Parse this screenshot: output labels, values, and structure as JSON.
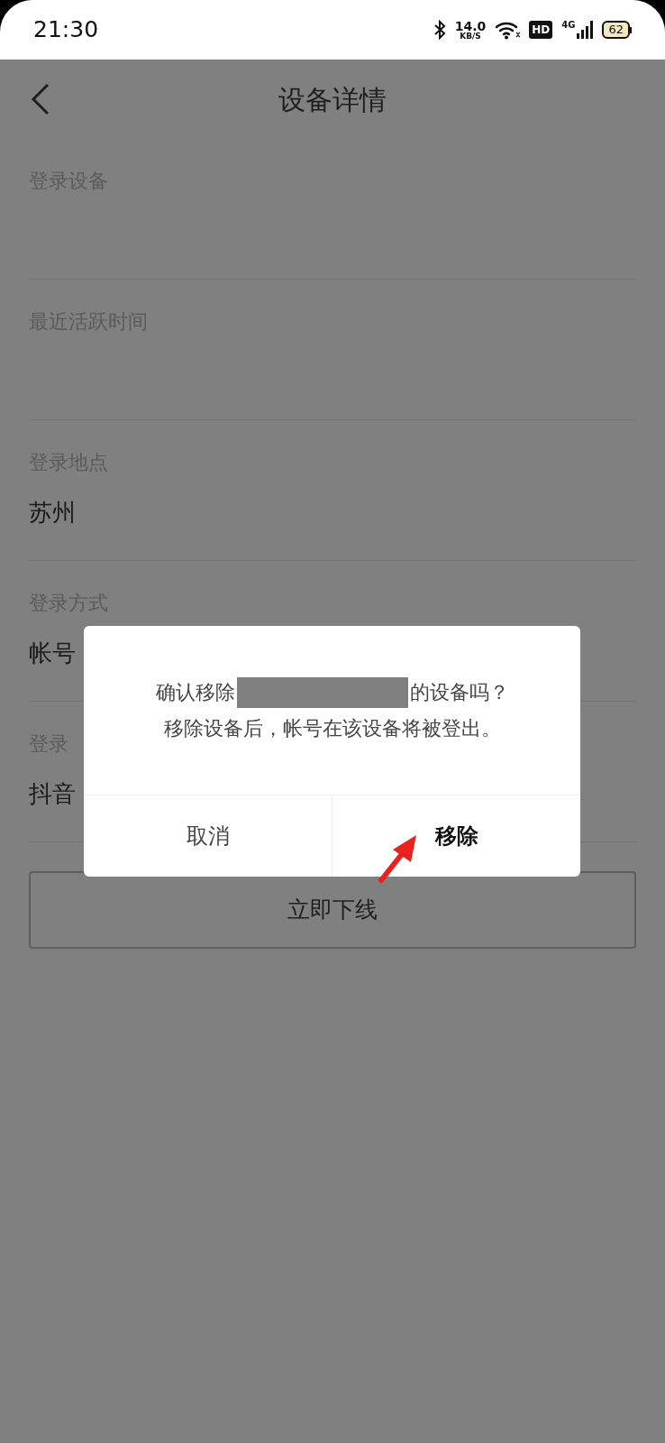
{
  "status_bar": {
    "time": "21:30",
    "net_speed": "14.0",
    "net_unit": "KB/S",
    "hd": "HD",
    "network": "4G",
    "battery": "62"
  },
  "header": {
    "title": "设备详情"
  },
  "fields": [
    {
      "label": "登录设备"
    },
    {
      "label": "最近活跃时间"
    },
    {
      "label": "登录地点",
      "value": "苏州"
    },
    {
      "label": "登录方式",
      "value": "帐号"
    },
    {
      "label": "登录",
      "value": "抖音"
    }
  ],
  "offline_button": "立即下线",
  "dialog": {
    "message_before": "确认移除",
    "message_after": "的设备吗？",
    "message_line2": "移除设备后，帐号在该设备将被登出。",
    "buttons": [
      {
        "label": "取消",
        "kind": "cancel"
      },
      {
        "label": "移除",
        "kind": "confirm"
      }
    ]
  }
}
